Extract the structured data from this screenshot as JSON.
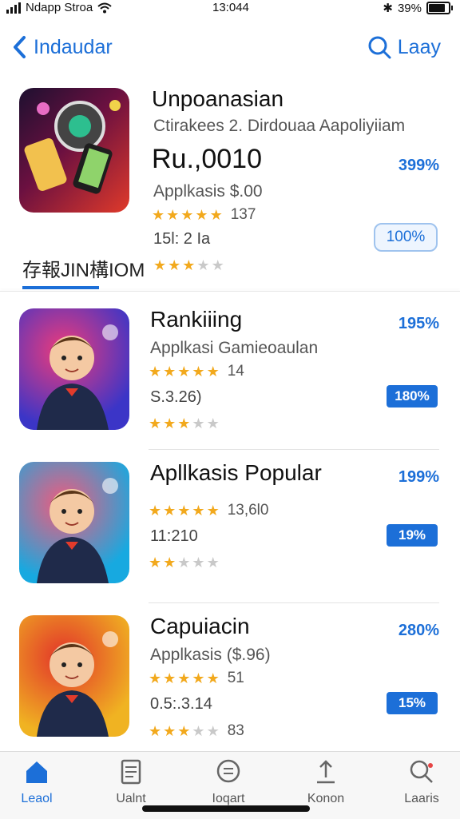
{
  "status": {
    "carrier": "Ndapp Stroa",
    "time": "13:044",
    "battery": "39%",
    "battery_level": 0.9
  },
  "nav": {
    "back_label": "Indaudar",
    "search_label": "Laay"
  },
  "featured": {
    "name": "Unpoanasian",
    "subtitle": "Ctirakees 2. Dirdouaa Aapoliyiiam",
    "price": "Ru.,0010",
    "category": "Applkasis $.00",
    "rating_count": "137",
    "meta": "15l: 2 Ia",
    "percent": "399%",
    "action": "100%",
    "stars": 4.5,
    "secondary_label": "存報JIN構IOM",
    "secondary_stars": 3,
    "icon_colors": [
      "#7a1030",
      "#e0402a"
    ]
  },
  "apps": [
    {
      "name": "Rankiiing",
      "category": "Applkasi Gamieoaulan",
      "rating_count": "14",
      "meta": "S.3.26)",
      "percent": "195%",
      "badge": "180%",
      "stars": 4.5,
      "stars2": 2.5,
      "icon_colors": [
        "#3b35c7",
        "#ef3b7a"
      ]
    },
    {
      "name": "Apllkasis Popular",
      "category": "",
      "rating_count": "13,6l0",
      "meta": "11:210",
      "percent": "199%",
      "badge": "19%",
      "stars": 5,
      "stars2": 1.5,
      "icon_colors": [
        "#17a9e0",
        "#f25a7c"
      ]
    },
    {
      "name": "Capuiacin",
      "category": "Applkasis ($.96)",
      "rating_count": "51",
      "meta": "0.5:.3.14",
      "percent": "280%",
      "badge": "15%",
      "stars": 5,
      "stars2": 3,
      "extra": "83",
      "icon_colors": [
        "#f0b322",
        "#e2332a"
      ]
    }
  ],
  "tabs": [
    {
      "label": "Leaol",
      "icon": "home-icon"
    },
    {
      "label": "Ualnt",
      "icon": "document-icon"
    },
    {
      "label": "Ioqart",
      "icon": "chat-icon"
    },
    {
      "label": "Konon",
      "icon": "upload-icon"
    },
    {
      "label": "Laaris",
      "icon": "search-icon"
    }
  ]
}
